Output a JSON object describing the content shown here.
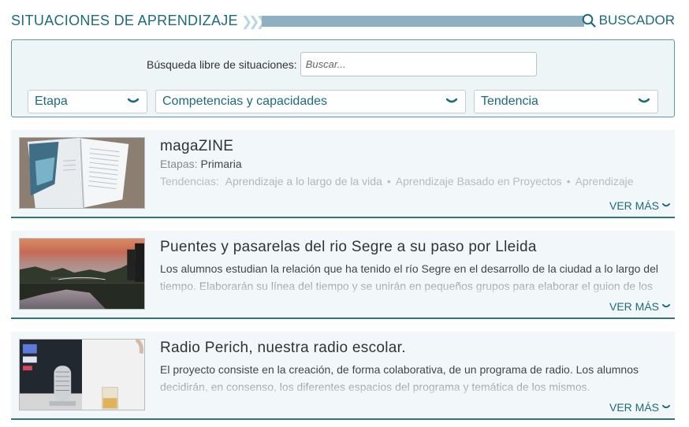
{
  "header": {
    "title": "SITUACIONES DE APRENDIZAJE",
    "finder_label": "BUSCADOR",
    "finder_icon": "search-icon",
    "accent": "#1c6b7d",
    "bar_color": "#8fb0c0"
  },
  "search": {
    "label": "Búsqueda libre de situaciones:",
    "placeholder": "Buscar...",
    "value": ""
  },
  "filters": [
    {
      "label": "Etapa",
      "icon": "chevron-down-icon"
    },
    {
      "label": "Competencias y capacidades",
      "icon": "chevron-down-icon"
    },
    {
      "label": "Tendencia",
      "icon": "chevron-down-icon"
    }
  ],
  "cards": [
    {
      "title": "magaZINE",
      "etapas_label": "Etapas:",
      "etapas_value": "Primaria",
      "tendencias_label": "Tendencias:",
      "tendencias": [
        "Aprendizaje a lo largo de la vida",
        "Aprendizaje Basado en Proyectos",
        "Aprendizaje"
      ],
      "more": "VER MÁS"
    },
    {
      "title": "Puentes y pasarelas del rio Segre a su paso por Lleida",
      "description": "Los alumnos estudian la relación que ha tenido el río Segre en el desarrollo de la ciudad a lo largo del tiempo. Elaborarán su línea del tiempo y se unirán en pequeños grupos para elaborar el guion de los",
      "more": "VER MÁS"
    },
    {
      "title": "Radio Perich, nuestra radio escolar.",
      "description": "El proyecto consiste en la creación, de forma colaborativa, de un programa de radio. Los alumnos decidirán, en consenso, los diferentes espacios del programa y temática de los mismos.",
      "more": "VER MÁS"
    }
  ]
}
